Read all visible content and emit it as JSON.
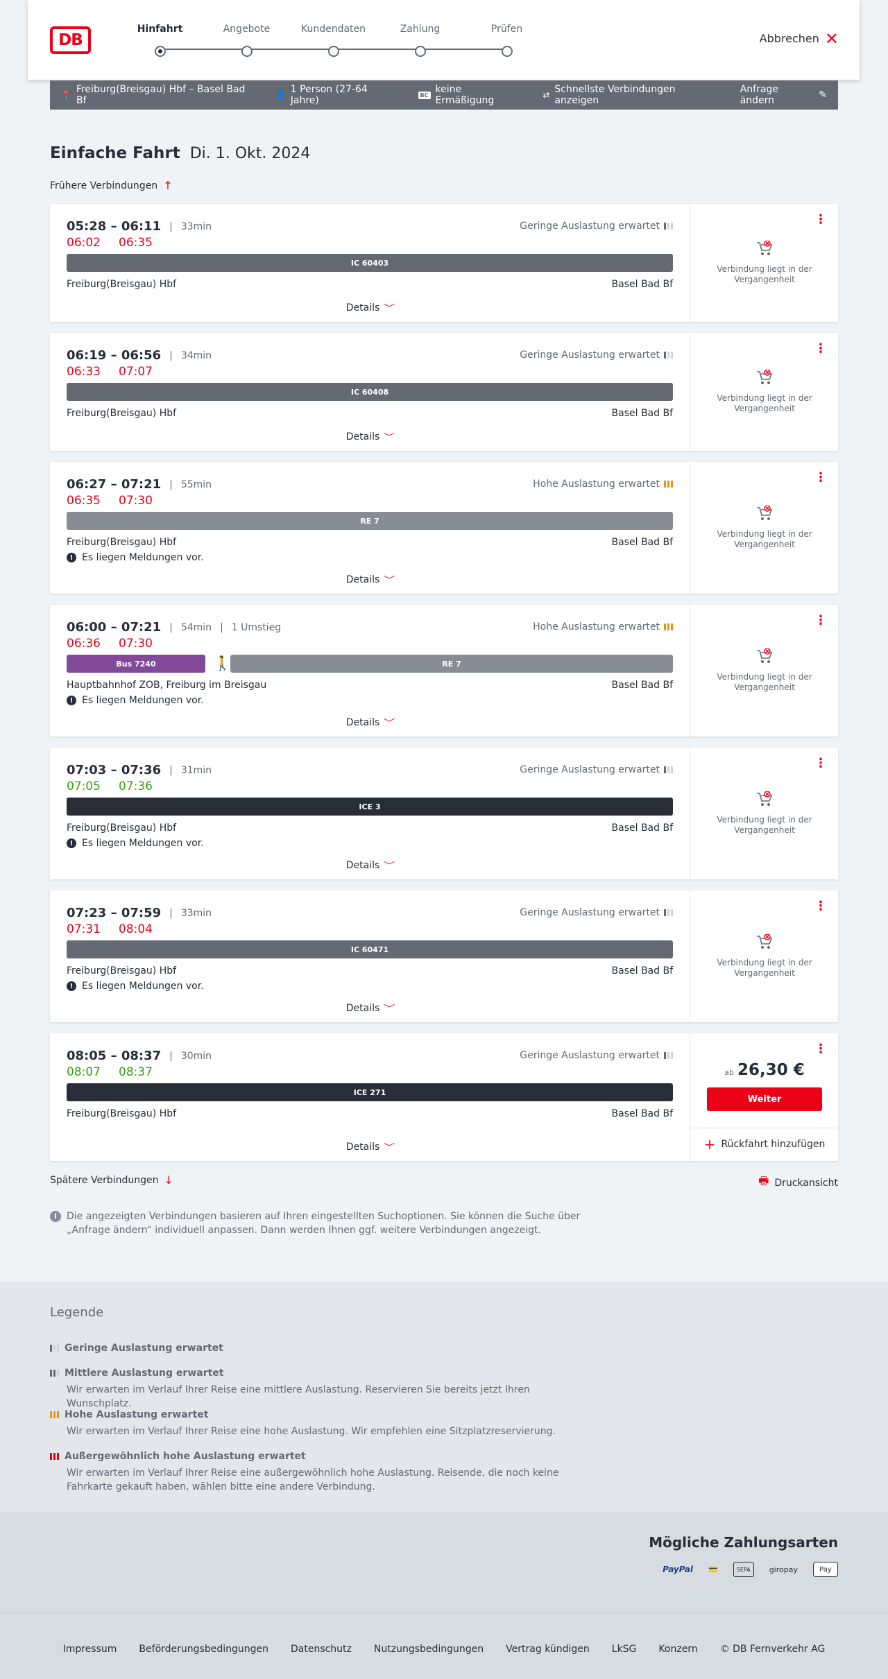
{
  "header": {
    "logo_text": "DB",
    "steps": [
      {
        "label": "Hinfahrt",
        "active": true
      },
      {
        "label": "Angebote",
        "active": false
      },
      {
        "label": "Kundendaten",
        "active": false
      },
      {
        "label": "Zahlung",
        "active": false
      },
      {
        "label": "Prüfen",
        "active": false
      }
    ],
    "cancel_label": "Abbrechen"
  },
  "search": {
    "route": "Freiburg(Breisgau) Hbf – Basel Bad Bf",
    "travellers": "1 Person (27-64 Jahre)",
    "discount_badge": "BC",
    "discount": "keine Ermäßigung",
    "mode": "Schnellste Verbindungen anzeigen",
    "edit_label": "Anfrage ändern"
  },
  "page": {
    "title": "Einfache Fahrt",
    "date": "Di. 1. Okt. 2024",
    "earlier_label": "Frühere Verbindungen",
    "later_label": "Spätere Verbindungen",
    "print_label": "Druckansicht",
    "info_text": "Die angezeigten Verbindungen basieren auf Ihren eingestellten Suchoptionen. Sie können die Suche über „Anfrage ändern“ individuell anpassen. Dann werden Ihnen ggf. weitere Verbindungen angezeigt."
  },
  "connections": [
    {
      "times": "05:28 – 06:11",
      "duration": "33min",
      "rt_dep": "06:02",
      "rt_arr": "06:35",
      "occupancy": "Geringe Auslastung erwartet",
      "train": "IC 60403",
      "from": "Freiburg(Breisgau) Hbf",
      "to": "Basel Bad Bf",
      "details": "Details",
      "past": "Verbindung liegt in der Vergangenheit"
    },
    {
      "times": "06:19 – 06:56",
      "duration": "34min",
      "rt_dep": "06:33",
      "rt_arr": "07:07",
      "occupancy": "Geringe Auslastung erwartet",
      "train": "IC 60408",
      "from": "Freiburg(Breisgau) Hbf",
      "to": "Basel Bad Bf",
      "details": "Details",
      "past": "Verbindung liegt in der Vergangenheit"
    },
    {
      "times": "06:27 – 07:21",
      "duration": "55min",
      "rt_dep": "06:35",
      "rt_arr": "07:30",
      "occupancy": "Hohe Auslastung erwartet",
      "train": "RE 7",
      "from": "Freiburg(Breisgau) Hbf",
      "to": "Basel Bad Bf",
      "notice": "Es liegen Meldungen vor.",
      "details": "Details",
      "past": "Verbindung liegt in der Vergangenheit"
    },
    {
      "times": "06:00 – 07:21",
      "duration": "54min",
      "transfers": "1 Umstieg",
      "rt_dep": "06:36",
      "rt_arr": "07:30",
      "occupancy": "Hohe Auslastung erwartet",
      "bus": "Bus 7240",
      "train": "RE 7",
      "from": "Hauptbahnhof ZOB, Freiburg im Breisgau",
      "to": "Basel Bad Bf",
      "notice": "Es liegen Meldungen vor.",
      "details": "Details",
      "past": "Verbindung liegt in der Vergangenheit"
    },
    {
      "times": "07:03 – 07:36",
      "duration": "31min",
      "rt_dep": "07:05",
      "rt_arr": "07:36",
      "occupancy": "Geringe Auslastung erwartet",
      "train": "ICE 3",
      "from": "Freiburg(Breisgau) Hbf",
      "to": "Basel Bad Bf",
      "notice": "Es liegen Meldungen vor.",
      "details": "Details",
      "past": "Verbindung liegt in der Vergangenheit"
    },
    {
      "times": "07:23 – 07:59",
      "duration": "33min",
      "rt_dep": "07:31",
      "rt_arr": "08:04",
      "occupancy": "Geringe Auslastung erwartet",
      "train": "IC 60471",
      "from": "Freiburg(Breisgau) Hbf",
      "to": "Basel Bad Bf",
      "notice": "Es liegen Meldungen vor.",
      "details": "Details",
      "past": "Verbindung liegt in der Vergangenheit"
    },
    {
      "times": "08:05 – 08:37",
      "duration": "30min",
      "rt_dep": "08:07",
      "rt_arr": "08:37",
      "occupancy": "Geringe Auslastung erwartet",
      "train": "ICE 271",
      "from": "Freiburg(Breisgau) Hbf",
      "to": "Basel Bad Bf",
      "details": "Details",
      "price_prefix": "ab",
      "price": "26,30 €",
      "continue_label": "Weiter",
      "return_label": "Rückfahrt hinzufügen"
    }
  ],
  "legend": {
    "title": "Legende",
    "items": [
      {
        "title": "Geringe Auslastung erwartet",
        "desc": ""
      },
      {
        "title": "Mittlere Auslastung erwartet",
        "desc": "Wir erwarten im Verlauf Ihrer Reise eine mittlere Auslastung. Reservieren Sie bereits jetzt Ihren Wunschplatz."
      },
      {
        "title": "Hohe Auslastung erwartet",
        "desc": "Wir erwarten im Verlauf Ihrer Reise eine hohe Auslastung. Wir empfehlen eine Sitzplatzreservierung."
      },
      {
        "title": "Außergewöhnlich hohe Auslastung erwartet",
        "desc": "Wir erwarten im Verlauf Ihrer Reise eine außergewöhnlich hohe Auslastung. Reisende, die noch keine Fahrkarte gekauft haben, wählen bitte eine andere Verbindung."
      }
    ]
  },
  "payments": {
    "title": "Mögliche Zahlungsarten",
    "methods": [
      "PayPal",
      "SEPA",
      "giropay",
      "Pay"
    ]
  },
  "footer": {
    "links": [
      "Impressum",
      "Beförderungsbedingungen",
      "Datenschutz",
      "Nutzungsbedingungen",
      "Vertrag kündigen",
      "LkSG",
      "Konzern",
      "© DB Fernverkehr AG"
    ]
  },
  "colors": {
    "brand": "#ec0016",
    "delay": "#ec0016",
    "ontime": "#37a20d",
    "bus": "#814997"
  }
}
